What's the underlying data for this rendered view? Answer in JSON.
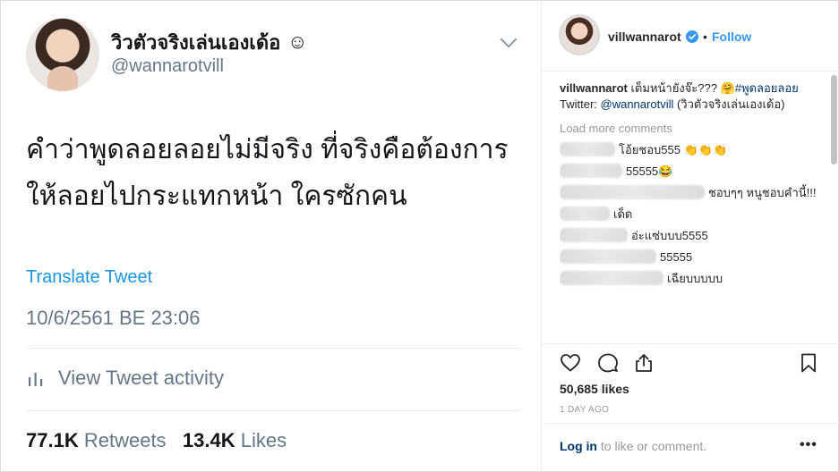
{
  "tweet": {
    "display_name": "วิวตัวจริงเล่นเองเด้อ",
    "emoji": "☺",
    "handle": "@wannarotvill",
    "text": "คำว่าพูดลอยลอยไม่มีจริง ที่จริงคือต้องการ ให้ลอยไปกระแทกหน้า ใครซักคน",
    "translate_label": "Translate Tweet",
    "timestamp": "10/6/2561 BE 23:06",
    "activity_label": "View Tweet activity",
    "retweets_count": "77.1K",
    "retweets_label": "Retweets",
    "likes_count": "13.4K",
    "likes_label": "Likes"
  },
  "instagram": {
    "username": "villwannarot",
    "separator": "•",
    "follow_label": "Follow",
    "caption_user": "villwannarot",
    "caption_text": "เต็มหน้ายังจ๊ะ??? 🤗",
    "caption_hashtag": "#พูดลอยลอย",
    "twitter_prefix": "Twitter: ",
    "twitter_handle": "@wannarotvill",
    "twitter_suffix": " (วิวตัวจริงเล่นเองเด้อ)",
    "load_more_label": "Load more comments",
    "comments": [
      {
        "text": "โอ้ยชอบ555 👏👏👏"
      },
      {
        "text": "55555😂"
      },
      {
        "text": "ชอบๆๆ หนูชอบคำนี้!!!"
      },
      {
        "text": "เด็ด"
      },
      {
        "text": "อ่ะแซ่บบบ5555"
      },
      {
        "text": "55555"
      },
      {
        "text": "เฉียบบบบบ"
      }
    ],
    "likes_text": "50,685 likes",
    "time_ago": "1 DAY AGO",
    "login_link": "Log in",
    "login_suffix": " to like or comment.",
    "more_label": "•••",
    "icons": [
      "heart-icon",
      "comment-icon",
      "share-icon",
      "bookmark-icon",
      "verified-badge-icon"
    ],
    "accent_color": "#3897f0",
    "verified_color": "#3897f0"
  }
}
